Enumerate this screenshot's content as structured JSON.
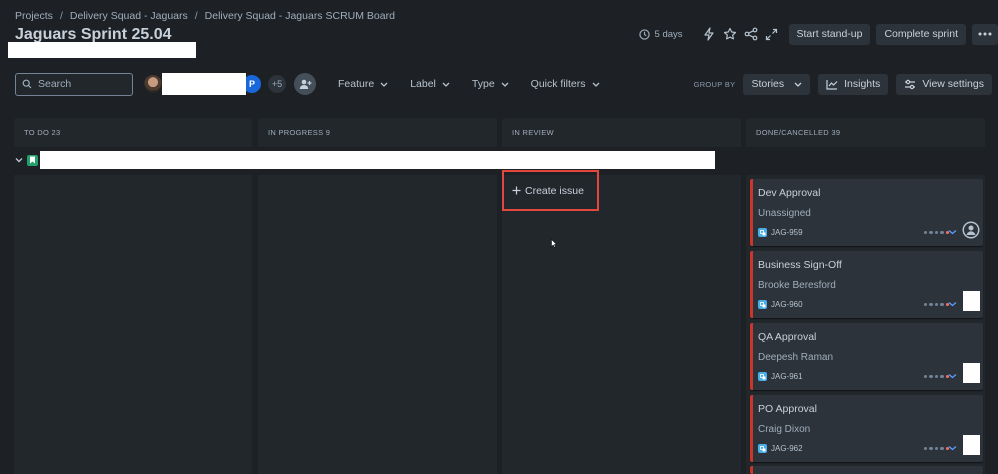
{
  "breadcrumbs": [
    "Projects",
    "Delivery Squad - Jaguars",
    "Delivery Squad - Jaguars SCRUM Board"
  ],
  "title": "Jaguars Sprint 25.04",
  "header": {
    "days_remaining": "5 days",
    "start_standup": "Start stand-up",
    "complete_sprint": "Complete sprint"
  },
  "toolbar": {
    "search_placeholder": "Search",
    "avatar_p": "P",
    "avatar_more": "+5",
    "filters": [
      "Feature",
      "Label",
      "Type",
      "Quick filters"
    ],
    "group_by_label": "GROUP BY",
    "group_by_value": "Stories",
    "insights": "Insights",
    "view_settings": "View settings"
  },
  "columns": [
    {
      "name": "TO DO 23"
    },
    {
      "name": "IN PROGRESS 9"
    },
    {
      "name": "IN REVIEW"
    },
    {
      "name": "DONE/CANCELLED 39"
    }
  ],
  "create_issue": "Create issue",
  "cards": [
    {
      "title": "Dev Approval",
      "assignee": "Unassigned",
      "key": "JAG-959"
    },
    {
      "title": "Business Sign-Off",
      "assignee": "Brooke Beresford",
      "key": "JAG-960"
    },
    {
      "title": "QA Approval",
      "assignee": "Deepesh Raman",
      "key": "JAG-961"
    },
    {
      "title": "PO Approval",
      "assignee": "Craig Dixon",
      "key": "JAG-962"
    }
  ],
  "colors": {
    "background": "#1d2125",
    "column": "#22272b",
    "card": "#2c333a",
    "card_flag": "#c9372c",
    "highlight": "#e2483d"
  }
}
